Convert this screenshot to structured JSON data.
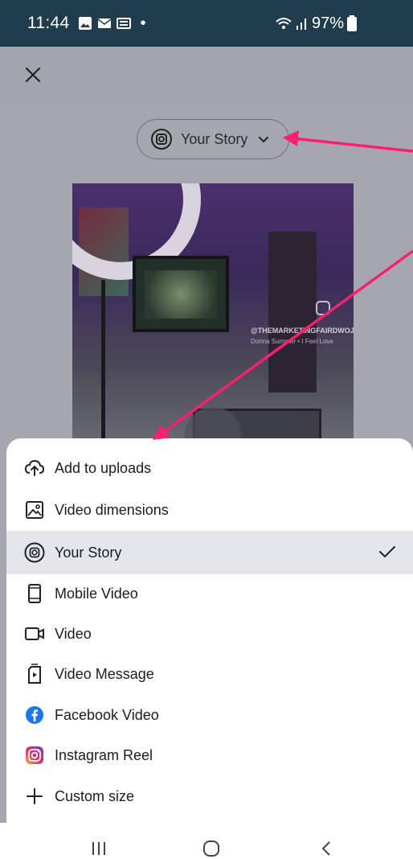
{
  "status_bar": {
    "time": "11:44",
    "battery": "97%",
    "icons": [
      "image-notification-icon",
      "mail-notification-icon",
      "news-notification-icon",
      "wifi-icon",
      "signal-icon",
      "battery-icon"
    ]
  },
  "header": {
    "close_icon": "close-icon"
  },
  "format_selector": {
    "label": "Your Story",
    "icon": "instagram-story-icon"
  },
  "preview": {
    "watermark_handle": "@THEMARKETINGFAIRDWOJE",
    "watermark_caption": "Donna Summer • I Feel Love"
  },
  "menu": {
    "items": [
      {
        "label": "Add to uploads",
        "icon": "cloud-upload-icon",
        "selected": false
      },
      {
        "label": "Video dimensions",
        "icon": "image-dimensions-icon",
        "selected": false
      },
      {
        "label": "Your Story",
        "icon": "instagram-story-icon",
        "selected": true
      },
      {
        "label": "Mobile Video",
        "icon": "phone-icon",
        "selected": false
      },
      {
        "label": "Video",
        "icon": "video-camera-icon",
        "selected": false
      },
      {
        "label": "Video Message",
        "icon": "video-message-icon",
        "selected": false
      },
      {
        "label": "Facebook Video",
        "icon": "facebook-icon",
        "selected": false
      },
      {
        "label": "Instagram Reel",
        "icon": "instagram-icon",
        "selected": false
      },
      {
        "label": "Custom size",
        "icon": "plus-icon",
        "selected": false
      }
    ]
  },
  "colors": {
    "status_bar_bg": "#1f3d4d",
    "selected_row_bg": "#e4e6ea",
    "annotation_arrow": "#ff1f6b",
    "facebook_blue": "#1877f2"
  },
  "nav_bar": {
    "icons": [
      "recent-apps-icon",
      "home-icon",
      "back-icon"
    ]
  }
}
